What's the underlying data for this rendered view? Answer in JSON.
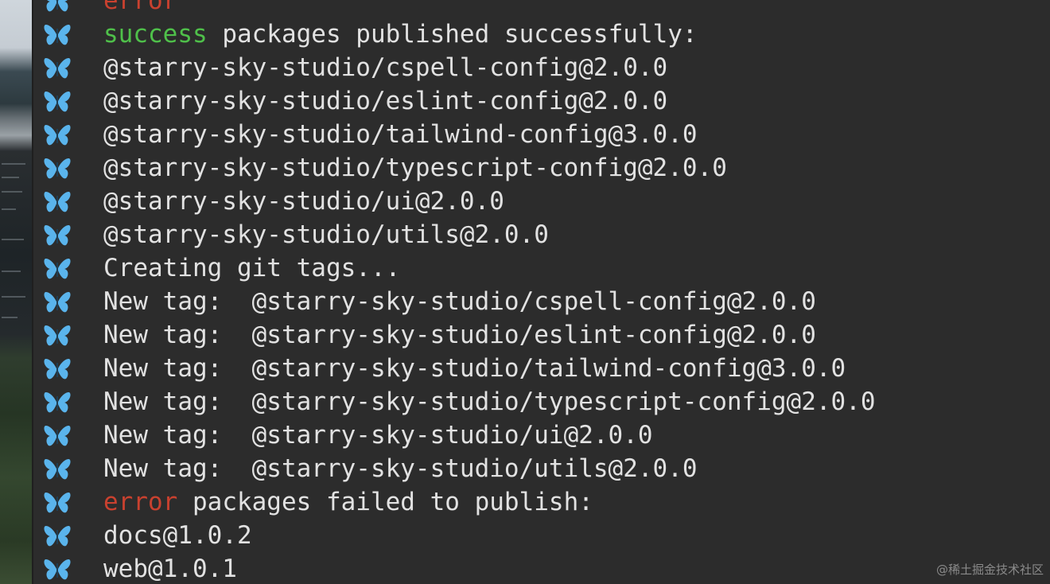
{
  "colors": {
    "background": "#2c2c2c",
    "text": "#e2e2e2",
    "success": "#4fc04a",
    "error": "#c9412f",
    "butterfly": "#5ab4ec"
  },
  "prompt_icon": "butterfly-icon",
  "lines": [
    {
      "keyword": "error",
      "keyword_type": "error",
      "rest": ""
    },
    {
      "keyword": "success",
      "keyword_type": "success",
      "rest": " packages published successfully:"
    },
    {
      "keyword": "",
      "keyword_type": "",
      "rest": "@starry-sky-studio/cspell-config@2.0.0"
    },
    {
      "keyword": "",
      "keyword_type": "",
      "rest": "@starry-sky-studio/eslint-config@2.0.0"
    },
    {
      "keyword": "",
      "keyword_type": "",
      "rest": "@starry-sky-studio/tailwind-config@3.0.0"
    },
    {
      "keyword": "",
      "keyword_type": "",
      "rest": "@starry-sky-studio/typescript-config@2.0.0"
    },
    {
      "keyword": "",
      "keyword_type": "",
      "rest": "@starry-sky-studio/ui@2.0.0"
    },
    {
      "keyword": "",
      "keyword_type": "",
      "rest": "@starry-sky-studio/utils@2.0.0"
    },
    {
      "keyword": "",
      "keyword_type": "",
      "rest": "Creating git tags..."
    },
    {
      "keyword": "",
      "keyword_type": "",
      "rest": "New tag:  @starry-sky-studio/cspell-config@2.0.0"
    },
    {
      "keyword": "",
      "keyword_type": "",
      "rest": "New tag:  @starry-sky-studio/eslint-config@2.0.0"
    },
    {
      "keyword": "",
      "keyword_type": "",
      "rest": "New tag:  @starry-sky-studio/tailwind-config@3.0.0"
    },
    {
      "keyword": "",
      "keyword_type": "",
      "rest": "New tag:  @starry-sky-studio/typescript-config@2.0.0"
    },
    {
      "keyword": "",
      "keyword_type": "",
      "rest": "New tag:  @starry-sky-studio/ui@2.0.0"
    },
    {
      "keyword": "",
      "keyword_type": "",
      "rest": "New tag:  @starry-sky-studio/utils@2.0.0"
    },
    {
      "keyword": "error",
      "keyword_type": "error",
      "rest": " packages failed to publish:"
    },
    {
      "keyword": "",
      "keyword_type": "",
      "rest": "docs@1.0.2"
    },
    {
      "keyword": "",
      "keyword_type": "",
      "rest": "web@1.0.1"
    }
  ],
  "watermark": "@稀土掘金技术社区"
}
